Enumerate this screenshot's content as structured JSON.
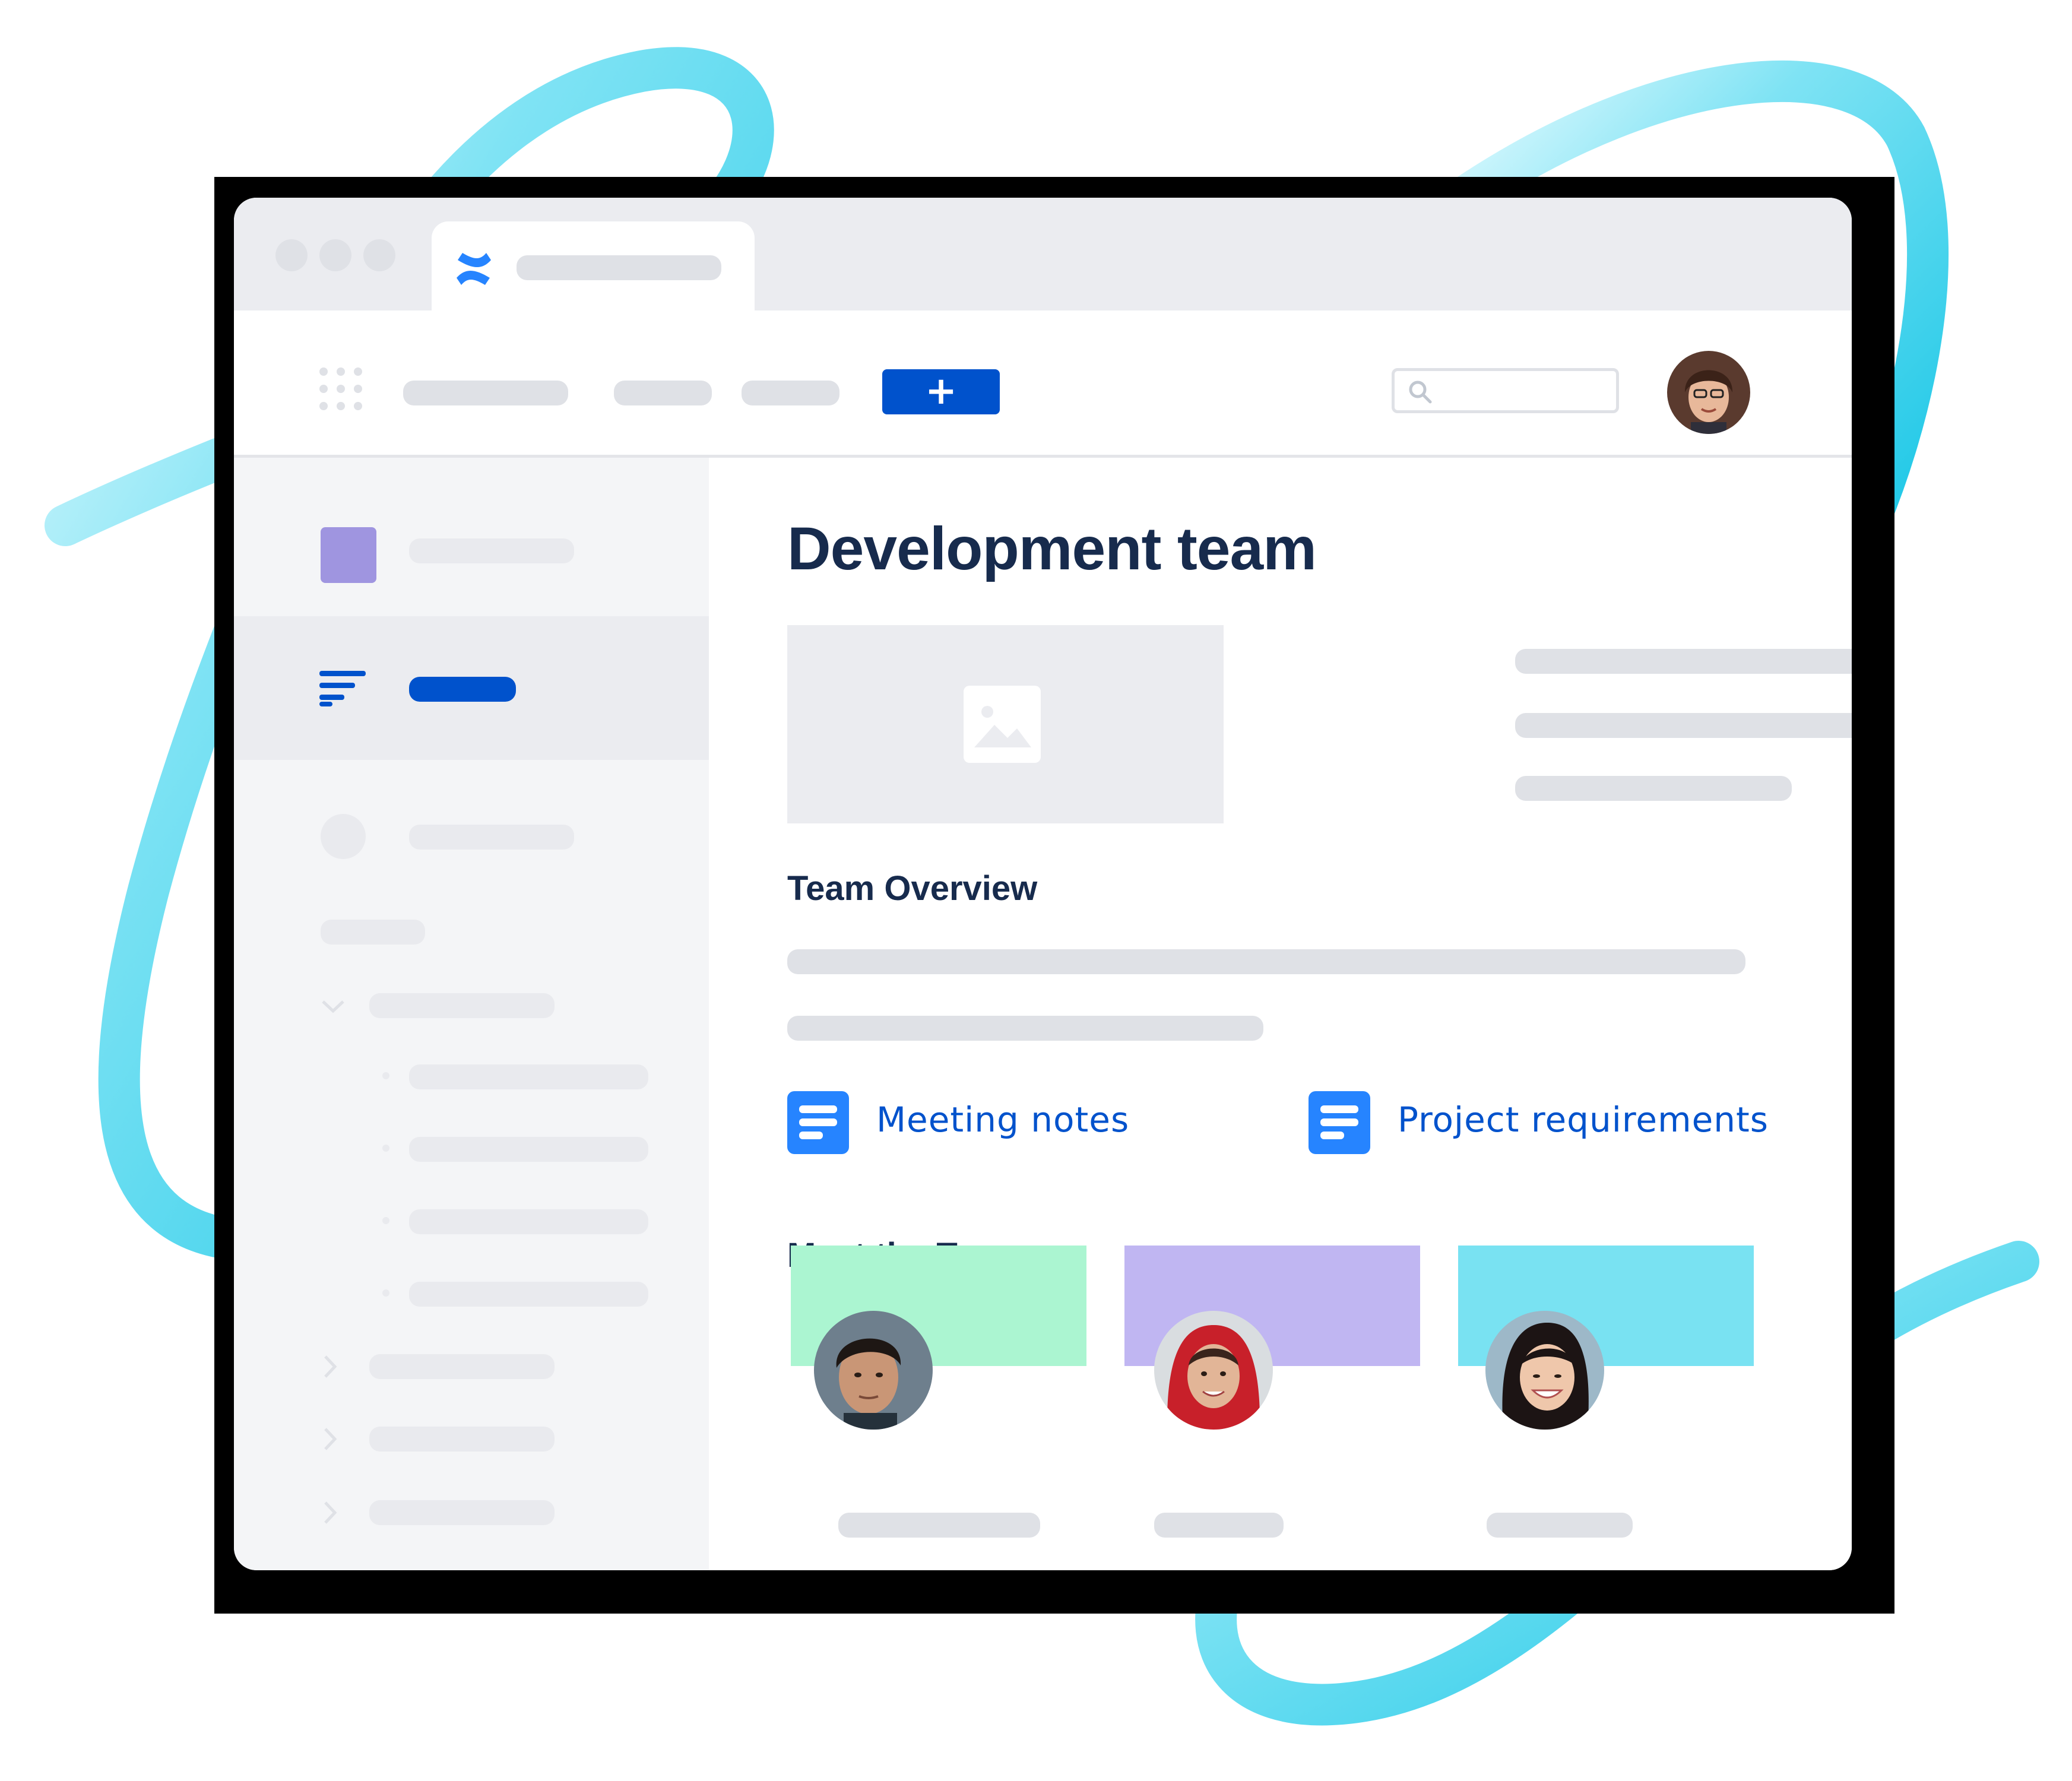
{
  "page": {
    "title": "Development team",
    "sections": {
      "overview_heading": "Team Overview",
      "team_heading": "Meet the Team"
    },
    "links": [
      {
        "label": "Meeting notes",
        "icon": "document-icon"
      },
      {
        "label": "Project requirements",
        "icon": "document-icon"
      }
    ],
    "team_cards": [
      {
        "header_color": "#abf5d1",
        "avatar": "avatar-man-dark-hair"
      },
      {
        "header_color": "#c0b6f2",
        "avatar": "avatar-woman-red-hood"
      },
      {
        "header_color": "#79e2f2",
        "avatar": "avatar-woman-smiling"
      }
    ]
  },
  "header": {
    "create_label": "+",
    "app_logo": "confluence-logo-icon",
    "search_icon": "search-icon",
    "profile_avatar": "avatar-woman-glasses"
  },
  "sidebar": {
    "space_color": "#9f95e0",
    "active_icon": "overview-lines-icon",
    "active_color": "#0052cc"
  },
  "colors": {
    "brand": "#0052cc",
    "heading": "#172b4d",
    "swirl": "#4fd8f0",
    "placeholder": "#dfe1e6"
  }
}
